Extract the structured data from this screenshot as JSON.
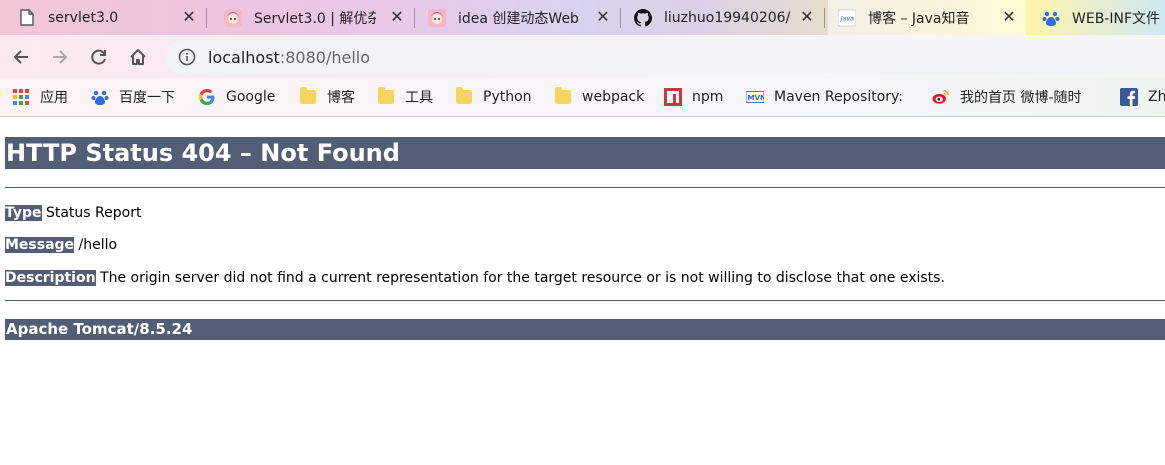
{
  "tabs": [
    {
      "title": "servlet3.0",
      "icon": "document-icon"
    },
    {
      "title": "Servlet3.0 | 解优杂",
      "icon": "anime-avatar-icon"
    },
    {
      "title": "idea 创建动态Web",
      "icon": "anime-avatar-icon"
    },
    {
      "title": "liuzhuo19940206/",
      "icon": "github-icon"
    },
    {
      "title": "博客 – Java知音",
      "icon": "java-icon"
    },
    {
      "title": "WEB-INF文件",
      "icon": "baidu-paw-icon"
    }
  ],
  "toolbar": {
    "url_host": "localhost",
    "url_path": ":8080/hello"
  },
  "bookmarks": [
    {
      "label": "应用",
      "icon": "apps-grid-icon"
    },
    {
      "label": "百度一下",
      "icon": "baidu-paw-icon"
    },
    {
      "label": "Google",
      "icon": "google-icon"
    },
    {
      "label": "博客",
      "icon": "folder-icon"
    },
    {
      "label": "工具",
      "icon": "folder-icon"
    },
    {
      "label": "Python",
      "icon": "folder-icon"
    },
    {
      "label": "webpack",
      "icon": "folder-icon"
    },
    {
      "label": "npm",
      "icon": "npm-icon"
    },
    {
      "label": "Maven Repository:",
      "icon": "mvn-icon"
    },
    {
      "label": "我的首页 微博-随时",
      "icon": "weibo-icon"
    },
    {
      "label": "Zh",
      "icon": "facebook-icon"
    }
  ],
  "page": {
    "heading": "HTTP Status 404 – Not Found",
    "type_label": "Type",
    "type_value": " Status Report",
    "message_label": "Message",
    "message_value": " /hello",
    "description_label": "Description",
    "description_value": " The origin server did not find a current representation for the target resource or is not willing to disclose that one exists.",
    "footer": "Apache Tomcat/8.5.24"
  },
  "colors": {
    "tomcat_bar": "#525d76"
  }
}
